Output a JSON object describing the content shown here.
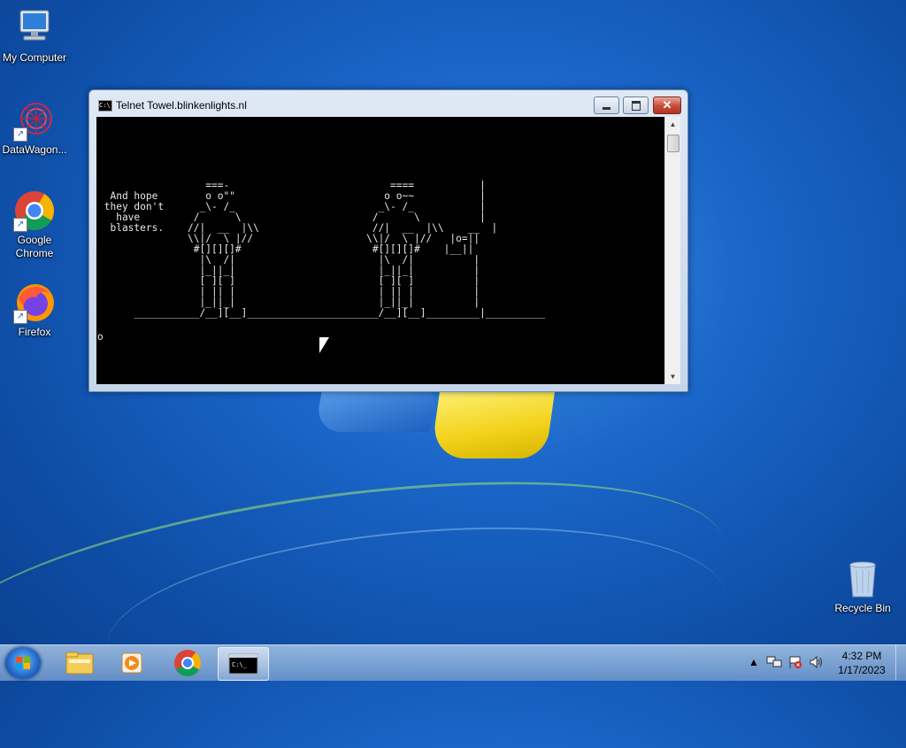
{
  "desktop": {
    "icons": [
      {
        "label": "My Computer",
        "icon": "computer-icon"
      },
      {
        "label": "DataWagon...",
        "icon": "datawagon-icon"
      },
      {
        "label": "Google Chrome",
        "icon": "chrome-icon"
      },
      {
        "label": "Firefox",
        "icon": "firefox-icon"
      },
      {
        "label": "Recycle Bin",
        "icon": "recycle-bin-icon"
      }
    ]
  },
  "window": {
    "title": "Telnet Towel.blinkenlights.nl",
    "close_glyph": "✕",
    "console_lines": [
      "                  ===-                           ====           |",
      "  And hope        o o\"\"                         o o~~           |",
      " they don't      _\\- /_                        _\\- /_           |",
      "   have         /      \\                      /      \\          |",
      "  blasters.    //|  __  |\\\\                   //|  __  |\\\\    __  |",
      "               \\\\|/  \\ |//                   \\\\|/  \\ |//   |o=||",
      "                #[][][]#                      #[][][]#    |__||",
      "                 |\\  /|                        |\\  /|          |",
      "                 |_||_|                        |_||_|          |",
      "                 [ ][ ]                        [ ][ ]          |",
      "                 | || |                        | || |          |",
      "                 |_||_|                        |_||_|          |",
      "      ___________/__][__]______________________/__][__]_________|__________"
    ],
    "prompt": "o"
  },
  "taskbar": {
    "apps": [
      "windows-explorer-icon",
      "media-player-icon",
      "chrome-icon",
      "command-prompt-icon"
    ],
    "clock_time": "4:32 PM",
    "clock_date": "1/17/2023"
  }
}
